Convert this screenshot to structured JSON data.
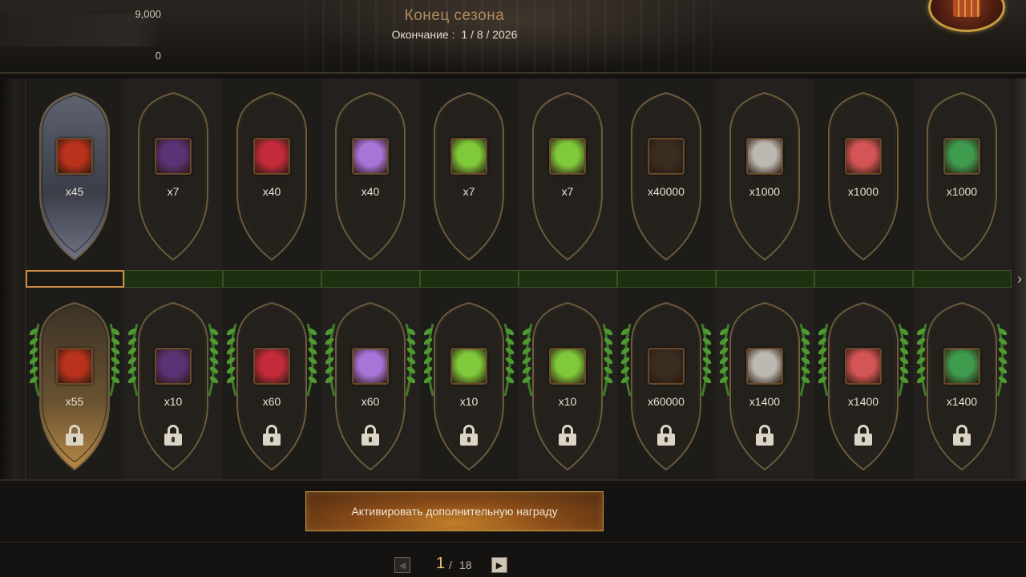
{
  "header": {
    "points_top": "9,000",
    "points_bottom": "0",
    "season_title": "Конец сезона",
    "end_label": "Окончание :",
    "end_date": "1 / 8 / 2026"
  },
  "free_rewards": [
    {
      "icon": "red-chest-icon",
      "qty": "x45"
    },
    {
      "icon": "purple-banner-icon",
      "qty": "x7"
    },
    {
      "icon": "red-scroll-icon",
      "qty": "x40"
    },
    {
      "icon": "violet-scroll-icon",
      "qty": "x40"
    },
    {
      "icon": "green-scroll-icon",
      "qty": "x7"
    },
    {
      "icon": "green-scroll-icon",
      "qty": "x7"
    },
    {
      "icon": "gold-bar-icon",
      "qty": "x40000"
    },
    {
      "icon": "grey-stone-icon",
      "qty": "x1000"
    },
    {
      "icon": "red-stone-icon",
      "qty": "x1000"
    },
    {
      "icon": "green-gem-icon",
      "qty": "x1000"
    }
  ],
  "premium_rewards": [
    {
      "icon": "red-chest-icon",
      "qty": "x55"
    },
    {
      "icon": "purple-banner-icon",
      "qty": "x10"
    },
    {
      "icon": "red-scroll-icon",
      "qty": "x60"
    },
    {
      "icon": "violet-scroll-icon",
      "qty": "x60"
    },
    {
      "icon": "green-scroll-icon",
      "qty": "x10"
    },
    {
      "icon": "green-scroll-icon",
      "qty": "x10"
    },
    {
      "icon": "gold-bar-icon",
      "qty": "x60000"
    },
    {
      "icon": "grey-stone-icon",
      "qty": "x1400"
    },
    {
      "icon": "red-stone-icon",
      "qty": "x1400"
    },
    {
      "icon": "green-gem-icon",
      "qty": "x1400"
    }
  ],
  "icon_colors": {
    "red-chest-icon": "#b8321c",
    "purple-banner-icon": "#5b3275",
    "red-scroll-icon": "#c42b3a",
    "violet-scroll-icon": "#a774d8",
    "green-scroll-icon": "#7fc93a",
    "gold-bar-icon": "#3a2d20",
    "grey-stone-icon": "#bdb9b2",
    "red-stone-icon": "#d45555",
    "green-gem-icon": "#3f9b4e"
  },
  "progress": {
    "current_level": 1,
    "levels": 10
  },
  "activate_button": "Активировать дополнительную награду",
  "pager": {
    "current": "1",
    "separator": "/",
    "total": "18"
  },
  "colors": {
    "accent_gold": "#c79a40",
    "progress_green": "#1c3110"
  }
}
